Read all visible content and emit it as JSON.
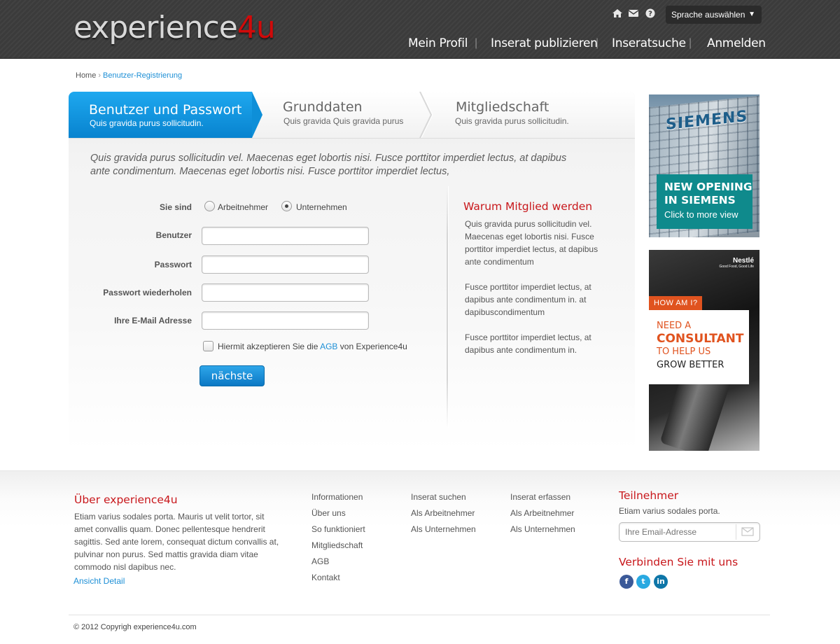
{
  "header": {
    "logo_main": "experience",
    "logo_accent": "4u",
    "icons": [
      "home-icon",
      "mail-icon",
      "help-icon"
    ],
    "language_select": "Sprache auswählen",
    "nav": [
      "Mein Profil",
      "Inserat publizieren",
      "Inseratsuche",
      "Anmelden"
    ]
  },
  "breadcrumb": {
    "home": "Home",
    "current": "Benutzer-Registrierung"
  },
  "steps": [
    {
      "title": "Benutzer und Passwort",
      "subtitle": "Quis gravida purus sollicitudin."
    },
    {
      "title": "Grunddaten",
      "subtitle": "Quis gravida Quis gravida purus"
    },
    {
      "title": "Mitgliedschaft",
      "subtitle": "Quis gravida purus sollicitudin."
    }
  ],
  "intro": "Quis gravida purus sollicitudin vel. Maecenas eget lobortis nisi. Fusce porttitor imperdiet lectus, at dapibus ante condimentum. Maecenas eget lobortis nisi. Fusce porttitor imperdiet lectus,",
  "form": {
    "type_label": "Sie sind",
    "type_options": [
      "Arbeitnehmer",
      "Unternehmen"
    ],
    "type_selected": "Unternehmen",
    "user_label": "Benutzer",
    "password_label": "Passwort",
    "password_repeat_label": "Passwort wiederholen",
    "email_label": "Ihre E-Mail Adresse",
    "agb_prefix": "Hiermit akzeptieren Sie die",
    "agb_link": "AGB",
    "agb_suffix": "von Experience4u",
    "next_button": "nächste"
  },
  "why": {
    "title": "Warum Mitglied werden",
    "paragraphs": [
      "Quis gravida purus sollicitudin vel. Maecenas eget lobortis nisi. Fusce porttitor imperdiet lectus, at dapibus ante condimentum",
      "Fusce porttitor imperdiet lectus, at dapibus ante condimentum in. at dapibuscondimentum",
      "Fusce porttitor imperdiet lectus, at dapibus ante condimentum in."
    ]
  },
  "ads": {
    "siemens": {
      "brand": "SIEMENS",
      "line1": "NEW OPENING",
      "line2": "IN SIEMENS",
      "line3": "Click to more view"
    },
    "nestle": {
      "brand": "Nestlé",
      "tagline": "Good Food, Good Life",
      "badge": "HOW AM I?",
      "line1": "NEED A",
      "line2": "CONSULTANT",
      "line3": "TO HELP US",
      "line4": "GROW BETTER"
    }
  },
  "footer": {
    "about_title": "Über experience4u",
    "about_text": "Etiam varius sodales porta. Mauris ut velit tortor, sit amet convallis quam. Donec pellentesque hendrerit sagittis. Sed ante lorem, consequat dictum convallis at, pulvinar non purus. Sed mattis gravida diam vitae commodo nisl dapibus nec.",
    "about_link": "Ansicht Detail",
    "col1": [
      "Informationen",
      "Über uns",
      "So funktioniert",
      "Mitgliedschaft",
      "AGB",
      "Kontakt"
    ],
    "col2": [
      "Inserat suchen",
      "Als Arbeitnehmer",
      "Als Unternehmen"
    ],
    "col3": [
      "Inserat erfassen",
      "Als Arbeitnehmer",
      "Als Unternehmen"
    ],
    "newsletter_title": "Teilnehmer",
    "newsletter_text": "Etiam varius sodales porta.",
    "email_placeholder": "Ihre Email-Adresse",
    "connect_title": "Verbinden Sie mit uns",
    "social": [
      {
        "label": "f",
        "color": "#3b5998",
        "icon": "facebook-icon"
      },
      {
        "label": "t",
        "color": "#29a9e1",
        "icon": "twitter-icon"
      },
      {
        "label": "in",
        "color": "#0e76a8",
        "icon": "linkedin-icon"
      }
    ],
    "copyright": "© 2012 Copyrigh experience4u.com"
  }
}
